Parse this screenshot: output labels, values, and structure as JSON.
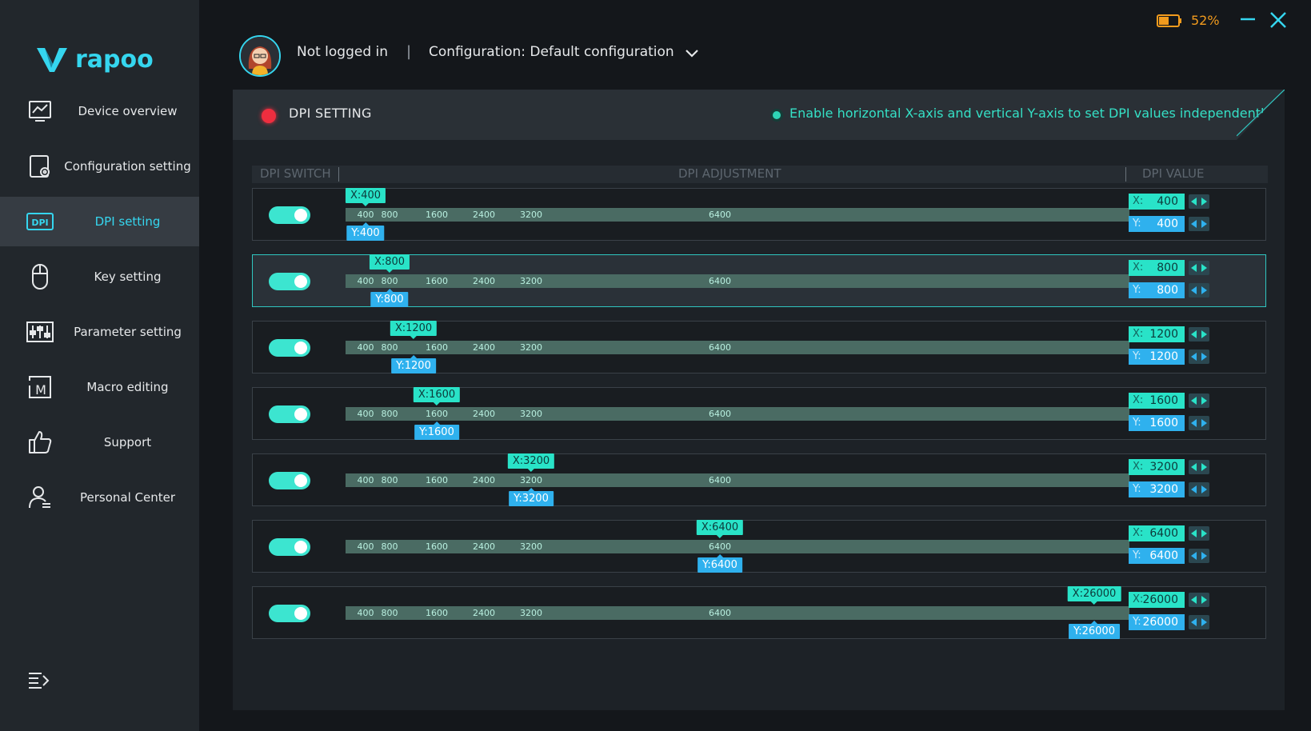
{
  "brand": {
    "name": "rapoo",
    "accent": "#35d6ef"
  },
  "sidebar": {
    "items": [
      {
        "label": "Device overview",
        "icon": "monitor-chart-icon",
        "active": false
      },
      {
        "label": "Configuration setting",
        "icon": "config-gear-icon",
        "active": false
      },
      {
        "label": "DPI setting",
        "icon": "dpi-icon",
        "active": true
      },
      {
        "label": "Key setting",
        "icon": "mouse-icon",
        "active": false
      },
      {
        "label": "Parameter setting",
        "icon": "sliders-icon",
        "active": false
      },
      {
        "label": "Macro editing",
        "icon": "macro-icon",
        "active": false
      },
      {
        "label": "Support",
        "icon": "thumbs-up-icon",
        "active": false
      },
      {
        "label": "Personal Center",
        "icon": "user-icon",
        "active": false
      }
    ],
    "collapse_icon": "menu-collapse-icon"
  },
  "topbar": {
    "login_status": "Not logged in",
    "separator": "|",
    "configuration": "Configuration: Default configuration",
    "battery_percent": "52%",
    "battery_level": 0.52,
    "battery_color": "#f29b1d"
  },
  "panel": {
    "title": "DPI SETTING",
    "independent_axes_option": "Enable horizontal X-axis and vertical Y-axis to set DPI values independently",
    "columns": {
      "switch": "DPI SWITCH",
      "adjustment": "DPI ADJUSTMENT",
      "value": "DPI VALUE"
    },
    "ticks": [
      "400",
      "800",
      "1600",
      "2400",
      "3200",
      "6400"
    ],
    "rows": [
      {
        "enabled": true,
        "selected": false,
        "x_marker": "X:400",
        "y_marker": "Y:400",
        "x_prefix": "X:",
        "y_prefix": "Y:",
        "x_value": "400",
        "y_value": "400"
      },
      {
        "enabled": true,
        "selected": true,
        "x_marker": "X:800",
        "y_marker": "Y:800",
        "x_prefix": "X:",
        "y_prefix": "Y:",
        "x_value": "800",
        "y_value": "800"
      },
      {
        "enabled": true,
        "selected": false,
        "x_marker": "X:1200",
        "y_marker": "Y:1200",
        "x_prefix": "X:",
        "y_prefix": "Y:",
        "x_value": "1200",
        "y_value": "1200"
      },
      {
        "enabled": true,
        "selected": false,
        "x_marker": "X:1600",
        "y_marker": "Y:1600",
        "x_prefix": "X:",
        "y_prefix": "Y:",
        "x_value": "1600",
        "y_value": "1600"
      },
      {
        "enabled": true,
        "selected": false,
        "x_marker": "X:3200",
        "y_marker": "Y:3200",
        "x_prefix": "X:",
        "y_prefix": "Y:",
        "x_value": "3200",
        "y_value": "3200"
      },
      {
        "enabled": true,
        "selected": false,
        "x_marker": "X:6400",
        "y_marker": "Y:6400",
        "x_prefix": "X:",
        "y_prefix": "Y:",
        "x_value": "6400",
        "y_value": "6400"
      },
      {
        "enabled": true,
        "selected": false,
        "x_marker": "X:26000",
        "y_marker": "Y:26000",
        "x_prefix": "X:",
        "y_prefix": "Y:",
        "x_value": "26000",
        "y_value": "26000"
      }
    ],
    "colors": {
      "x_marker": "#29e3c8",
      "y_marker": "#2fb1ee",
      "toggle_on": "#3ce5d0",
      "recording_dot": "#ee2e3f"
    }
  }
}
